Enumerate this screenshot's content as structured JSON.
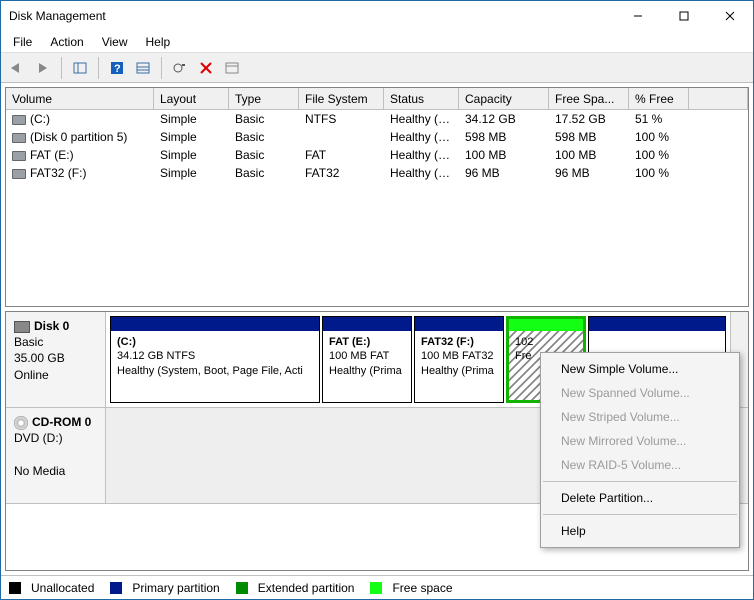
{
  "window": {
    "title": "Disk Management"
  },
  "menubar": [
    "File",
    "Action",
    "View",
    "Help"
  ],
  "columns": [
    "Volume",
    "Layout",
    "Type",
    "File System",
    "Status",
    "Capacity",
    "Free Spa...",
    "% Free"
  ],
  "volumes": [
    {
      "name": "(C:)",
      "layout": "Simple",
      "type": "Basic",
      "fs": "NTFS",
      "status": "Healthy (S...",
      "capacity": "34.12 GB",
      "free": "17.52 GB",
      "pct": "51 %"
    },
    {
      "name": "(Disk 0 partition 5)",
      "layout": "Simple",
      "type": "Basic",
      "fs": "",
      "status": "Healthy (P...",
      "capacity": "598 MB",
      "free": "598 MB",
      "pct": "100 %"
    },
    {
      "name": "FAT (E:)",
      "layout": "Simple",
      "type": "Basic",
      "fs": "FAT",
      "status": "Healthy (P...",
      "capacity": "100 MB",
      "free": "100 MB",
      "pct": "100 %"
    },
    {
      "name": "FAT32 (F:)",
      "layout": "Simple",
      "type": "Basic",
      "fs": "FAT32",
      "status": "Healthy (P...",
      "capacity": "96 MB",
      "free": "96 MB",
      "pct": "100 %"
    }
  ],
  "disk0": {
    "title": "Disk 0",
    "l1": "Basic",
    "l2": "35.00 GB",
    "l3": "Online",
    "parts": {
      "p0": {
        "title": "(C:)",
        "l2": "34.12 GB NTFS",
        "l3": "Healthy (System, Boot, Page File, Acti"
      },
      "p1": {
        "title": "FAT  (E:)",
        "l2": "100 MB FAT",
        "l3": "Healthy (Prima"
      },
      "p2": {
        "title": "FAT32  (F:)",
        "l2": "100 MB FAT32",
        "l3": "Healthy (Prima"
      },
      "p3": {
        "l2": "102",
        "l3": "Fre"
      }
    }
  },
  "cdrom": {
    "title": "CD-ROM 0",
    "l1": "DVD (D:)",
    "l2": "No Media"
  },
  "legend": {
    "unalloc": "Unallocated",
    "primary": "Primary partition",
    "extended": "Extended partition",
    "free": "Free space"
  },
  "ctx": {
    "simple": "New Simple Volume...",
    "spanned": "New Spanned Volume...",
    "striped": "New Striped Volume...",
    "mirrored": "New Mirrored Volume...",
    "raid5": "New RAID-5 Volume...",
    "del": "Delete Partition...",
    "help": "Help"
  }
}
